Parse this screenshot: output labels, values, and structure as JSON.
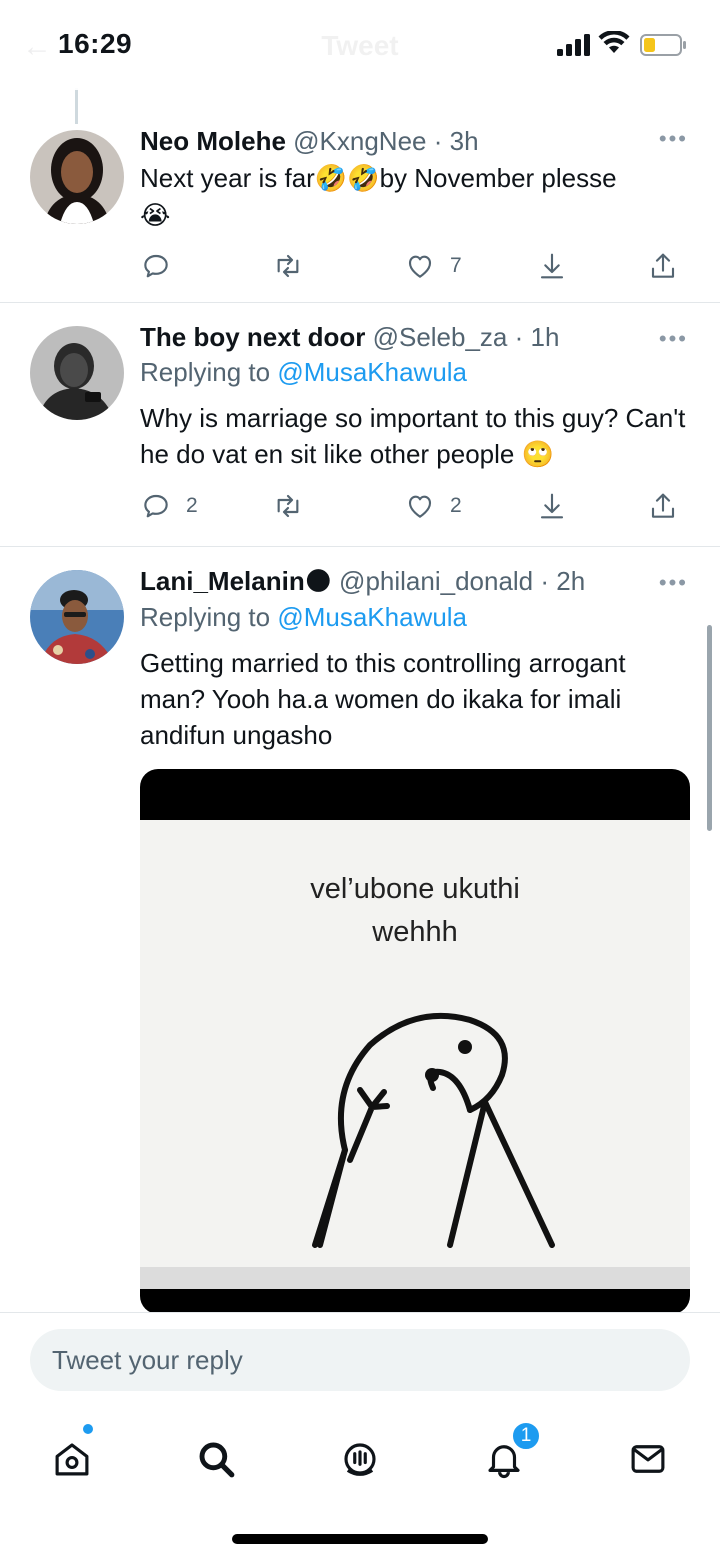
{
  "status_bar": {
    "time": "16:29"
  },
  "header": {
    "back_icon": "back-arrow-icon",
    "title": "Tweet"
  },
  "tweets": [
    {
      "name": "Neo Molehe",
      "handle": "@KxngNee",
      "time": "· 3h",
      "replying_label": "",
      "replying_to": "",
      "text_a": "Next year is far",
      "emoji_a": "🤣🤣",
      "text_b": "by November plesse",
      "emoji_b": "😭",
      "counts": {
        "reply": "",
        "retweet": "",
        "like": "7"
      }
    },
    {
      "name": "The boy next door",
      "handle": "@Seleb_za",
      "time": "· 1h",
      "replying_label": "Replying to",
      "replying_to": "@MusaKhawula",
      "text_a": "Why is marriage so important to this guy? Can't he do vat en sit like other people",
      "emoji_a": "🙄",
      "counts": {
        "reply": "2",
        "retweet": "",
        "like": "2"
      }
    },
    {
      "name": "Lani_Melanin",
      "name_emoji": "🌑",
      "handle": "@philani_donald",
      "time": "· 2h",
      "replying_label": "Replying to",
      "replying_to": "@MusaKhawula",
      "text_a": "Getting married to this controlling arrogant man? Yooh ha.a women do ikaka for imali andifun ungasho",
      "media_caption_1": "vel’ubone ukuthi",
      "media_caption_2": "wehhh"
    }
  ],
  "reply_box": {
    "placeholder": "Tweet your reply"
  },
  "tab_bar": {
    "items": [
      "home-icon",
      "search-icon",
      "spaces-icon",
      "notifications-icon",
      "messages-icon"
    ],
    "notification_badge": "1"
  },
  "colors": {
    "accent": "#1d9bf0",
    "text": "#0f1419",
    "secondary": "#536471"
  }
}
